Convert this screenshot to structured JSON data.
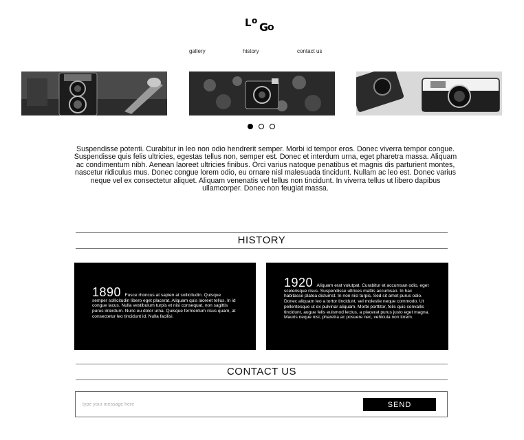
{
  "logo": {
    "text": "LOGO",
    "letters": [
      "L",
      "o",
      "G",
      "o"
    ]
  },
  "nav": {
    "items": [
      {
        "label": "gallery"
      },
      {
        "label": "history"
      },
      {
        "label": "contact us"
      }
    ]
  },
  "gallery": {
    "images": [
      {
        "name": "twin-lens-camera-photo"
      },
      {
        "name": "camera-with-flowers-photo"
      },
      {
        "name": "vintage-cameras-photo"
      }
    ],
    "active_slide": 1,
    "slide_count": 3
  },
  "intro": {
    "text": "Suspendisse potenti. Curabitur in leo non odio hendrerit semper. Morbi id tempor eros. Donec viverra tempor congue. Suspendisse quis felis ultricies, egestas tellus non, semper est. Donec et interdum urna, eget pharetra massa. Aliquam ac condimentum nibh. Aenean laoreet ultricies finibus. Orci varius natoque penatibus et magnis dis parturient montes, nascetur ridiculus mus. Donec congue lorem odio, eu ornare nisl malesuada tincidunt. Nullam ac leo est. Donec varius neque vel ex consectetur aliquet. Aliquam venenatis vel tellus non tincidunt. In viverra tellus ut libero dapibus ullamcorper. Donec non feugiat massa."
  },
  "history": {
    "heading": "HISTORY",
    "cards": [
      {
        "year": "1890",
        "text": "Fusce rhoncus at sapien at sollicitudin. Quisque semper sollicitudin libero eget placerat. Aliquam quis laoreet tellus. In id congue lacus. Nulla vestibulum turpis et nisi consequat, non sagittis purus interdum. Nunc eu dolor urna. Quisque fermentum risus quam, at consectetur leo tincidunt id. Nulla facilisi."
      },
      {
        "year": "1920",
        "text": "Aliquam erat volutpat. Curabitur et accumsan odio, eget scelerisque risus. Suspendisse ultrices mattis accumsan. In hac habitasse platea dictumst. In non nisl turpis. Sed sit amet purus odio. Donec aliquam leo a tortor tincidunt, vel molestie neque commodo. Ut pellentesque ut ex pulvinar aliquam. Morbi porttitor, felis quis convallis tincidunt, augue felis euismod lectus, a placerat purus justo eget magna. Mauris neque nisi, pharetra ac posuere nec, vehicula non lorem."
      }
    ]
  },
  "contact": {
    "heading": "CONTACT US",
    "message_placeholder": "type your message here",
    "message_value": "",
    "send_label": "SEND"
  },
  "colors": {
    "background": "#ffffff",
    "text": "#111111",
    "card_bg": "#000000",
    "button_bg": "#000000",
    "divider": "#777777"
  }
}
